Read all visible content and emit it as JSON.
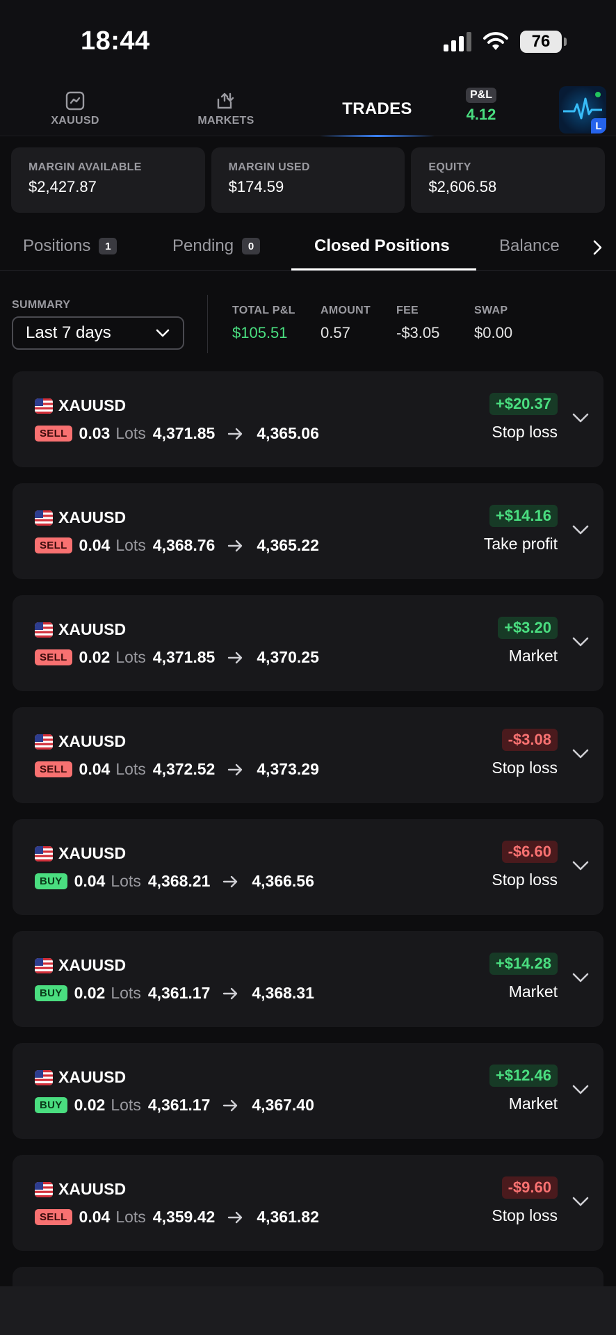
{
  "status_bar": {
    "time": "18:44",
    "battery": "76"
  },
  "nav": {
    "xauusd_label": "XAUUSD",
    "markets_label": "MARKETS",
    "trades_label": "TRADES",
    "pl_label": "P&L",
    "pl_value": "4.12",
    "avatar_badge": "L"
  },
  "margin": [
    {
      "label": "MARGIN AVAILABLE",
      "value": "$2,427.87"
    },
    {
      "label": "MARGIN USED",
      "value": "$174.59"
    },
    {
      "label": "EQUITY",
      "value": "$2,606.58"
    }
  ],
  "tabs": {
    "positions": {
      "label": "Positions",
      "count": "1"
    },
    "pending": {
      "label": "Pending",
      "count": "0"
    },
    "closed": {
      "label": "Closed Positions"
    },
    "balance": {
      "label": "Balance"
    }
  },
  "summary": {
    "label": "SUMMARY",
    "period": "Last 7 days",
    "total_pl_label": "TOTAL P&L",
    "total_pl": "$105.51",
    "amount_label": "AMOUNT",
    "amount": "0.57",
    "fee_label": "FEE",
    "fee": "-$3.05",
    "swap_label": "SWAP",
    "swap": "$0.00"
  },
  "lots_label": "Lots",
  "trades": [
    {
      "symbol": "XAUUSD",
      "side": "SELL",
      "lots": "0.03",
      "open": "4,371.85",
      "close": "4,365.06",
      "pnl": "+$20.37",
      "pnl_sign": "pos",
      "reason": "Stop loss"
    },
    {
      "symbol": "XAUUSD",
      "side": "SELL",
      "lots": "0.04",
      "open": "4,368.76",
      "close": "4,365.22",
      "pnl": "+$14.16",
      "pnl_sign": "pos",
      "reason": "Take profit"
    },
    {
      "symbol": "XAUUSD",
      "side": "SELL",
      "lots": "0.02",
      "open": "4,371.85",
      "close": "4,370.25",
      "pnl": "+$3.20",
      "pnl_sign": "pos",
      "reason": "Market"
    },
    {
      "symbol": "XAUUSD",
      "side": "SELL",
      "lots": "0.04",
      "open": "4,372.52",
      "close": "4,373.29",
      "pnl": "-$3.08",
      "pnl_sign": "neg",
      "reason": "Stop loss"
    },
    {
      "symbol": "XAUUSD",
      "side": "BUY",
      "lots": "0.04",
      "open": "4,368.21",
      "close": "4,366.56",
      "pnl": "-$6.60",
      "pnl_sign": "neg",
      "reason": "Stop loss"
    },
    {
      "symbol": "XAUUSD",
      "side": "BUY",
      "lots": "0.02",
      "open": "4,361.17",
      "close": "4,368.31",
      "pnl": "+$14.28",
      "pnl_sign": "pos",
      "reason": "Market"
    },
    {
      "symbol": "XAUUSD",
      "side": "BUY",
      "lots": "0.02",
      "open": "4,361.17",
      "close": "4,367.40",
      "pnl": "+$12.46",
      "pnl_sign": "pos",
      "reason": "Market"
    },
    {
      "symbol": "XAUUSD",
      "side": "SELL",
      "lots": "0.04",
      "open": "4,359.42",
      "close": "4,361.82",
      "pnl": "-$9.60",
      "pnl_sign": "neg",
      "reason": "Stop loss"
    }
  ],
  "colors": {
    "background": "#0d0d0f",
    "card": "#18181b",
    "positive": "#4ade80",
    "negative": "#f87171",
    "accent": "#3b82f6"
  }
}
